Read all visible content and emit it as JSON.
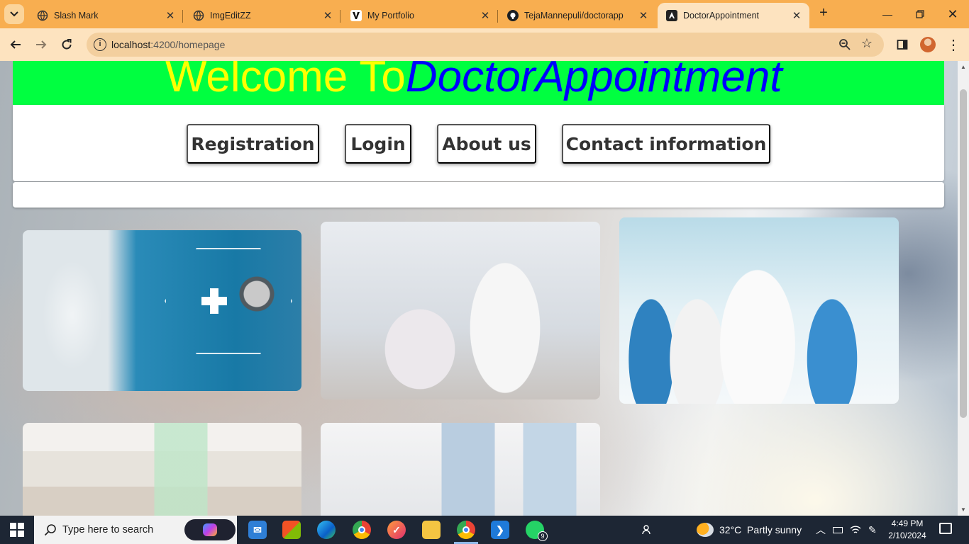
{
  "browser": {
    "tabs": [
      {
        "label": "Slash Mark",
        "icon": "globe-icon"
      },
      {
        "label": "ImgEditZZ",
        "icon": "globe-icon"
      },
      {
        "label": "My Portfolio",
        "icon": "vercel-icon"
      },
      {
        "label": "TejaMannepuli/doctorapp",
        "icon": "github-icon"
      },
      {
        "label": "DoctorAppointment",
        "icon": "angular-icon",
        "active": true
      }
    ],
    "url_host": "localhost",
    "url_path": ":4200/homepage"
  },
  "page": {
    "banner": {
      "welcome": "Welcome To",
      "brand": "DoctorAppointment"
    },
    "nav": [
      "Registration",
      "Login",
      "About us",
      "Contact information"
    ],
    "photos": [
      "stethoscope-tech-photo",
      "doctor-with-patient-photo",
      "medical-team-photo",
      "hospital-ward-photo",
      "hospital-room-photo"
    ]
  },
  "taskbar": {
    "search_placeholder": "Type here to search",
    "weather": "32°C  Partly sunny",
    "time": "4:49 PM",
    "date": "2/10/2024",
    "whatsapp_badge": "9"
  },
  "colors": {
    "tabbar": "#f8ae50",
    "toolbar": "#fde3bf",
    "banner_bg": "#00ff40",
    "welcome": "#ffff00",
    "brand": "#0000ff"
  }
}
